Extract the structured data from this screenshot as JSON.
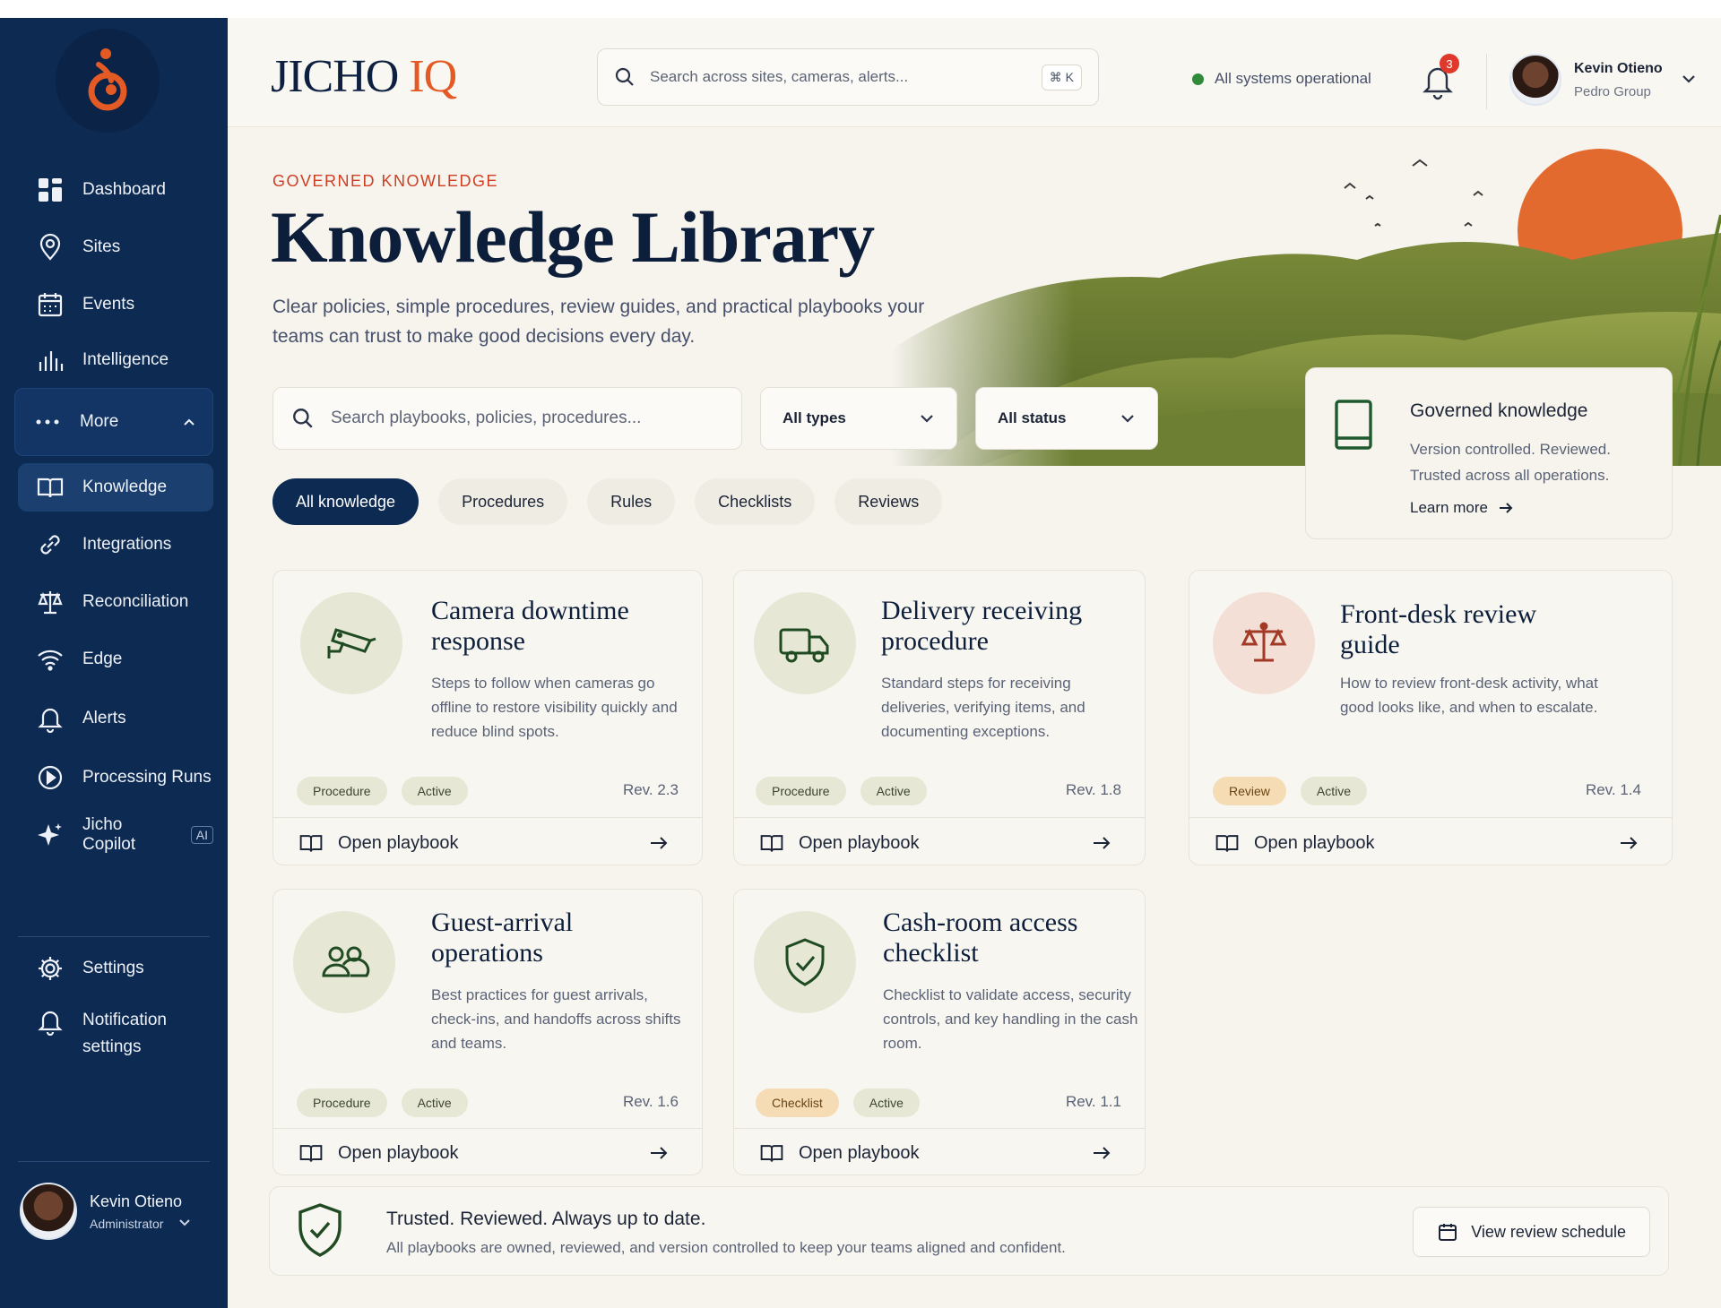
{
  "brand": {
    "name": "JICHO",
    "suffix": "IQ"
  },
  "topbar": {
    "search_placeholder": "Search across sites, cameras, alerts...",
    "shortcut": "⌘ K",
    "status": "All systems operational",
    "notifications_count": "3",
    "user_name": "Kevin Otieno",
    "user_org": "Pedro Group"
  },
  "sidebar": {
    "items": [
      {
        "label": "Dashboard",
        "icon": "grid-icon"
      },
      {
        "label": "Sites",
        "icon": "map-pin-icon"
      },
      {
        "label": "Events",
        "icon": "calendar-icon"
      },
      {
        "label": "Intelligence",
        "icon": "bar-chart-icon"
      },
      {
        "label": "More",
        "icon": "more-dots-icon"
      },
      {
        "label": "Knowledge",
        "icon": "book-icon"
      },
      {
        "label": "Integrations",
        "icon": "link-icon"
      },
      {
        "label": "Reconciliation",
        "icon": "scale-icon"
      },
      {
        "label": "Edge",
        "icon": "wifi-icon"
      },
      {
        "label": "Alerts",
        "icon": "bell-icon"
      },
      {
        "label": "Processing Runs",
        "icon": "play-icon"
      },
      {
        "label": "Jicho Copilot",
        "icon": "sparkle-icon",
        "badge": "AI"
      },
      {
        "label": "Settings",
        "icon": "gear-icon"
      },
      {
        "label": "Notification settings",
        "icon": "bell-icon"
      }
    ],
    "user": {
      "name": "Kevin Otieno",
      "role": "Administrator"
    }
  },
  "header": {
    "eyebrow": "GOVERNED KNOWLEDGE",
    "title": "Knowledge Library",
    "subtitle": "Clear policies, simple procedures, review guides, and practical playbooks your teams can trust to make good decisions every day."
  },
  "search": {
    "placeholder": "Search playbooks, policies, procedures..."
  },
  "filters_selects": {
    "type": "All types",
    "status": "All status"
  },
  "tabs": [
    "All knowledge",
    "Procedures",
    "Rules",
    "Checklists",
    "Reviews"
  ],
  "governed_card": {
    "title": "Governed knowledge",
    "text": "Version controlled. Reviewed. Trusted across all operations.",
    "link": "Learn more"
  },
  "cards": [
    {
      "title": "Camera downtime response",
      "desc": "Steps to follow when cameras go offline to restore visibility quickly and reduce blind spots.",
      "type": "Procedure",
      "status": "Active",
      "rev": "Rev. 2.3",
      "action": "Open playbook",
      "icon": "cctv-camera-icon"
    },
    {
      "title": "Delivery receiving procedure",
      "desc": "Standard steps for receiving deliveries, verifying items, and documenting exceptions.",
      "type": "Procedure",
      "status": "Active",
      "rev": "Rev. 1.8",
      "action": "Open playbook",
      "icon": "truck-icon"
    },
    {
      "title": "Front-desk review guide",
      "desc": "How to review front-desk activity, what good looks like, and when to escalate.",
      "type": "Review",
      "status": "Active",
      "rev": "Rev. 1.4",
      "action": "Open playbook",
      "icon": "scale-icon"
    },
    {
      "title": "Guest-arrival operations",
      "desc": "Best practices for guest arrivals, check-ins, and handoffs across shifts and teams.",
      "type": "Procedure",
      "status": "Active",
      "rev": "Rev. 1.6",
      "action": "Open playbook",
      "icon": "users-icon"
    },
    {
      "title": "Cash-room access checklist",
      "desc": "Checklist to validate access, security controls, and key handling in the cash room.",
      "type": "Checklist",
      "status": "Active",
      "rev": "Rev. 1.1",
      "action": "Open playbook",
      "icon": "shield-check-icon"
    }
  ],
  "trust": {
    "title": "Trusted. Reviewed. Always up to date.",
    "text": "All playbooks are owned, reviewed, and version controlled to keep your teams aligned and confident.",
    "button": "View review schedule"
  },
  "colors": {
    "sidebar": "#0d2a52",
    "accent": "#e35a25",
    "eyebrow": "#cf3e22",
    "status_ok": "#2f8a3a"
  }
}
